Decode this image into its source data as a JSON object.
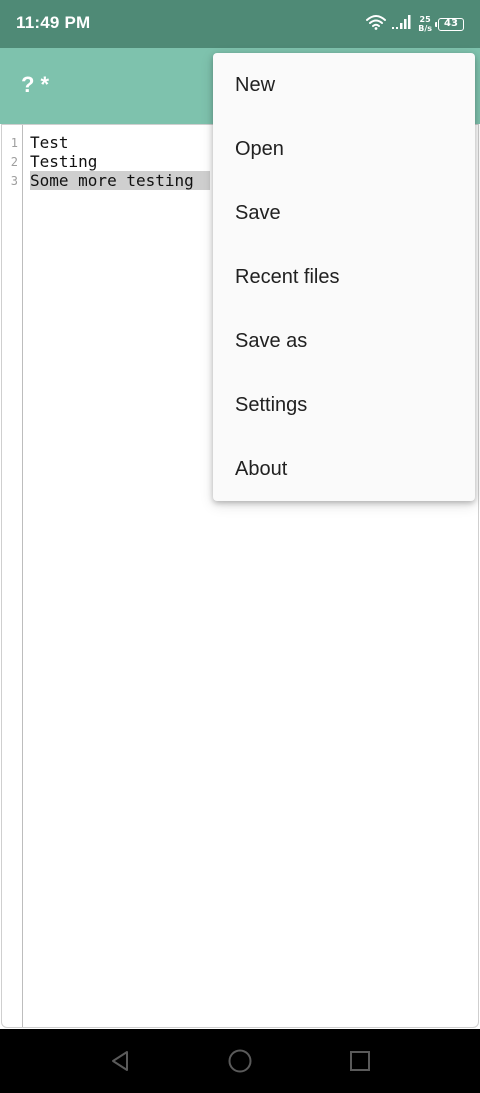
{
  "status_bar": {
    "time": "11:49 PM",
    "net_speed_value": "25",
    "net_speed_unit": "B/s",
    "battery_level": "43",
    "icons": [
      "wifi-icon",
      "signal-icon",
      "battery-icon"
    ]
  },
  "app_bar": {
    "title": "? *"
  },
  "editor": {
    "lines": [
      {
        "number": "1",
        "text": "Test"
      },
      {
        "number": "2",
        "text": "Testing"
      },
      {
        "number": "3",
        "text": "Some more testing"
      }
    ]
  },
  "menu": {
    "items": [
      {
        "label": "New"
      },
      {
        "label": "Open"
      },
      {
        "label": "Save"
      },
      {
        "label": "Recent files"
      },
      {
        "label": "Save as"
      },
      {
        "label": "Settings"
      },
      {
        "label": "About"
      }
    ]
  },
  "nav_bar": {
    "icons": [
      "back-icon",
      "home-icon",
      "recents-icon"
    ]
  },
  "colors": {
    "status_bar": "#4f8a76",
    "app_bar": "#7ec2ad",
    "selection": "#cfcfcf",
    "menu_background": "#fafafa"
  }
}
